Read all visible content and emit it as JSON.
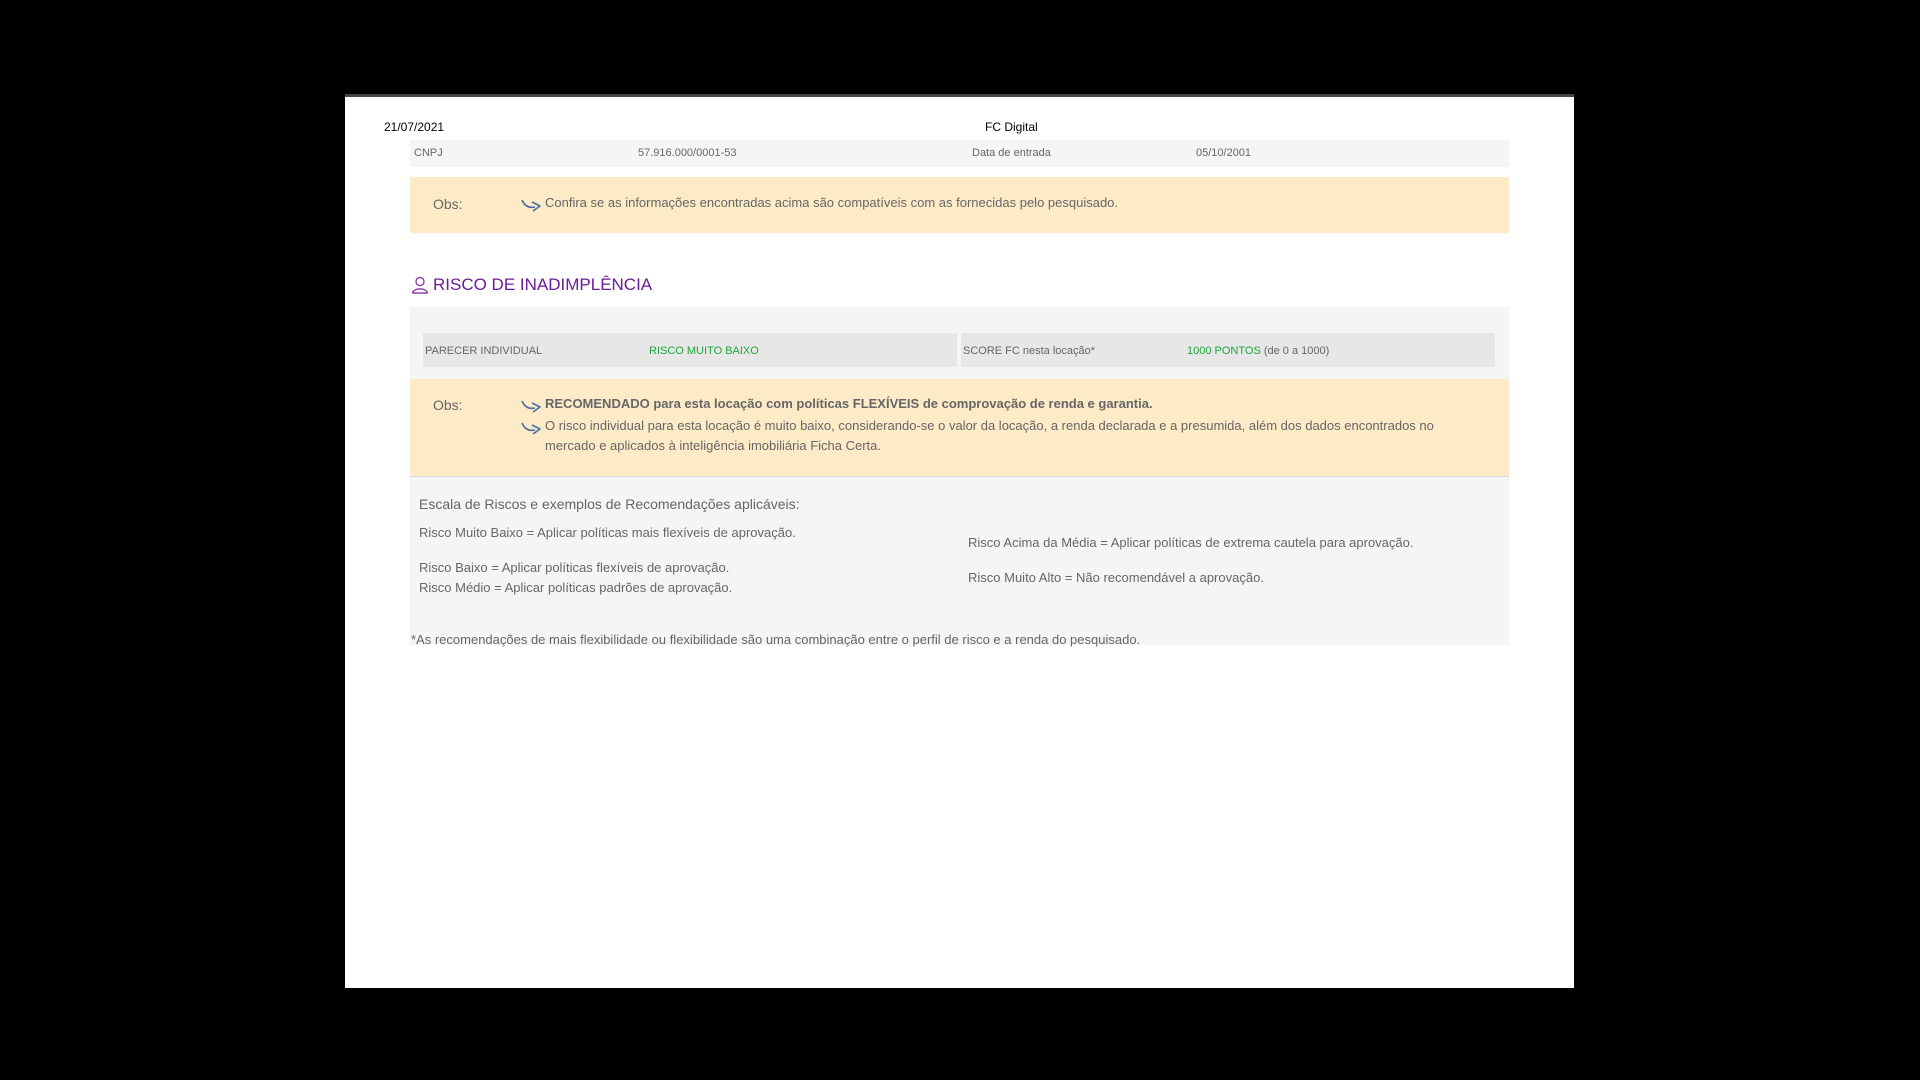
{
  "header": {
    "date": "21/07/2021",
    "title": "FC Digital"
  },
  "company": {
    "cnpj_label": "CNPJ",
    "cnpj_value": "57.916.000/0001-53",
    "entry_label": "Data de entrada",
    "entry_value": "05/10/2001"
  },
  "obs1": {
    "label": "Obs:",
    "text": "Confira se as informações encontradas acima são compatíveis com as fornecidas pelo pesquisado."
  },
  "risk": {
    "title": "RISCO DE INADIMPLÊNCIA",
    "parecer_label": "PARECER INDIVIDUAL",
    "parecer_value": "RISCO MUITO BAIXO",
    "score_label": "SCORE FC nesta locação*",
    "score_value": "1000 PONTOS",
    "score_range": "(de 0 a 1000)",
    "color_good": "#1aa83a",
    "color_title": "#6a1b9a"
  },
  "obs2": {
    "label": "Obs:",
    "line1": "RECOMENDADO para esta locação com políticas FLEXÍVEIS de comprovação de renda e garantia.",
    "line2a": "O risco individual para esta locação é muito baixo, considerando-se o valor da locação, a renda declarada e a presumida, além dos dados encontrados no",
    "line2b": "mercado e aplicados à inteligência imobiliária Ficha Certa."
  },
  "scale": {
    "title": "Escala de Riscos e exemplos de Recomendações aplicáveis:",
    "muito_baixo": "Risco Muito Baixo  = Aplicar políticas mais flexíveis de aprovação.",
    "baixo": "Risco Baixo  = Aplicar políticas flexíveis de aprovação.",
    "medio": "Risco Médio  = Aplicar políticas padrões de aprovação.",
    "acima_media": "Risco Acima da Média  = Aplicar políticas de extrema cautela para aprovação.",
    "muito_alto": "Risco Muito Alto  = Não recomendável a aprovação."
  },
  "footnote": "*As recomendações de mais flexibilidade ou flexibilidade são uma combinação entre o perfil de risco e a renda do pesquisado."
}
